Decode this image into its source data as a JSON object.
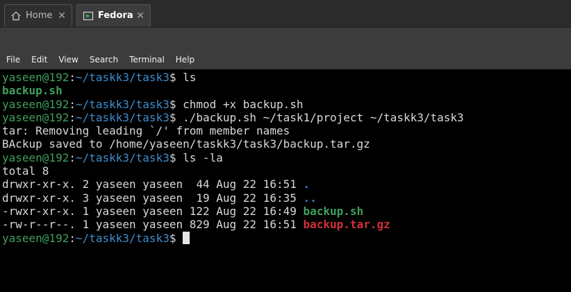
{
  "tabs": [
    {
      "label": "Home",
      "icon": "home-icon"
    },
    {
      "label": "Fedora",
      "icon": "terminal-app-icon",
      "active": true
    }
  ],
  "menu": [
    "File",
    "Edit",
    "View",
    "Search",
    "Terminal",
    "Help"
  ],
  "colors": {
    "prompt_user": "#3fa05c",
    "prompt_path": "#3f8ecf",
    "executable": "#3fa05c",
    "archive": "#d2303a",
    "directory": "#3a78d8"
  },
  "terminal": {
    "prompt_user": "yaseen@192",
    "prompt_path": "~/taskk3/task3",
    "prompt_symbol": "$",
    "lines": [
      {
        "type": "cmd",
        "text": " ls"
      },
      {
        "type": "exe",
        "text": "backup.sh"
      },
      {
        "type": "cmd",
        "text": " chmod +x backup.sh"
      },
      {
        "type": "cmd",
        "text": " ./backup.sh ~/task1/project ~/taskk3/task3"
      },
      {
        "type": "out",
        "text": "tar: Removing leading `/' from member names"
      },
      {
        "type": "out",
        "text": "BAckup saved to /home/yaseen/taskk3/task3/backup.tar.gz"
      },
      {
        "type": "cmd",
        "text": " ls -la"
      },
      {
        "type": "out",
        "text": "total 8"
      },
      {
        "type": "ls",
        "prefix": "drwxr-xr-x. 2 yaseen yaseen  44 Aug 22 16:51 ",
        "name": ".",
        "kind": "dir"
      },
      {
        "type": "ls",
        "prefix": "drwxr-xr-x. 3 yaseen yaseen  19 Aug 22 16:35 ",
        "name": "..",
        "kind": "dir"
      },
      {
        "type": "ls",
        "prefix": "-rwxr-xr-x. 1 yaseen yaseen 122 Aug 22 16:49 ",
        "name": "backup.sh",
        "kind": "exe"
      },
      {
        "type": "ls",
        "prefix": "-rw-r--r--. 1 yaseen yaseen 829 Aug 22 16:51 ",
        "name": "backup.tar.gz",
        "kind": "archive"
      },
      {
        "type": "cmd",
        "text": " ",
        "cursor": true
      }
    ]
  }
}
